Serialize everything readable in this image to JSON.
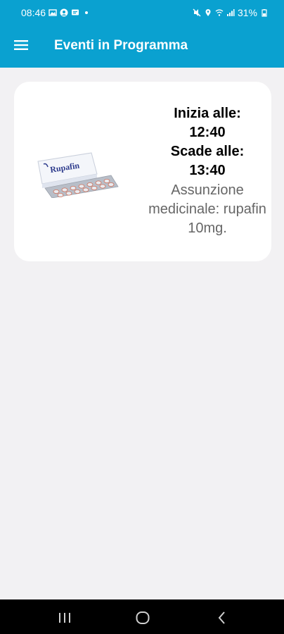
{
  "status_bar": {
    "time": "08:46",
    "battery": "31%"
  },
  "app_bar": {
    "title": "Eventi in Programma"
  },
  "event": {
    "start_label": "Inizia alle:",
    "start_time": "12:40",
    "end_label": "Scade alle:",
    "end_time": "13:40",
    "description": "Assunzione medicinale: rupafin 10mg.",
    "image_text": "Rupafin"
  },
  "colors": {
    "primary": "#0aa1d0",
    "background": "#f2f1f3",
    "card": "#ffffff"
  }
}
